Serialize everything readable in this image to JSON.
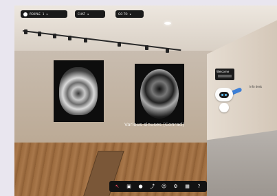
{
  "toolbar": {
    "people": {
      "label": "PEOPLE",
      "count": "1"
    },
    "chat": {
      "label": "CHAT"
    },
    "goto": {
      "label": "GO TO"
    }
  },
  "exhibit": {
    "caption": "Various sinuses (Conrad)",
    "sign_title": "Welcome",
    "far_label": "Info desk"
  },
  "bottom_toolbar": {
    "icons": [
      "pointer-icon",
      "camera-icon",
      "mic-icon",
      "share-icon",
      "emoji-icon",
      "settings-icon",
      "grid-icon",
      "help-icon"
    ]
  },
  "colors": {
    "toolbar_bg": "#1a1a1a",
    "accent": "#ff4f6a",
    "robot_wing": "#3d7fd6"
  }
}
